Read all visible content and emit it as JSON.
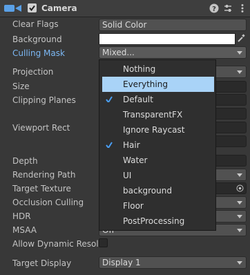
{
  "component": {
    "title": "Camera",
    "enabled": true
  },
  "fields": {
    "clear_flags": {
      "label": "Clear Flags",
      "value": "Solid Color"
    },
    "background": {
      "label": "Background"
    },
    "culling_mask": {
      "label": "Culling Mask",
      "value": "Mixed..."
    },
    "projection": {
      "label": "Projection"
    },
    "size": {
      "label": "Size"
    },
    "clipping_planes": {
      "label": "Clipping Planes"
    },
    "viewport_rect": {
      "label": "Viewport Rect"
    },
    "depth": {
      "label": "Depth"
    },
    "rendering_path": {
      "label": "Rendering Path"
    },
    "target_texture": {
      "label": "Target Texture"
    },
    "occlusion_culling": {
      "label": "Occlusion Culling"
    },
    "hdr": {
      "label": "HDR"
    },
    "msaa": {
      "label": "MSAA",
      "value": "Off"
    },
    "allow_dynamic_resolution": {
      "label": "Allow Dynamic Resolu"
    },
    "target_display": {
      "label": "Target Display",
      "value": "Display 1"
    }
  },
  "culling_mask_menu": {
    "options": [
      {
        "label": "Nothing",
        "checked": false,
        "highlighted": false
      },
      {
        "label": "Everything",
        "checked": false,
        "highlighted": true
      },
      {
        "label": "Default",
        "checked": true,
        "highlighted": false
      },
      {
        "label": "TransparentFX",
        "checked": false,
        "highlighted": false
      },
      {
        "label": "Ignore Raycast",
        "checked": false,
        "highlighted": false
      },
      {
        "label": "Hair",
        "checked": true,
        "highlighted": false
      },
      {
        "label": "Water",
        "checked": false,
        "highlighted": false
      },
      {
        "label": "UI",
        "checked": false,
        "highlighted": false
      },
      {
        "label": "background",
        "checked": false,
        "highlighted": false
      },
      {
        "label": "Floor",
        "checked": false,
        "highlighted": false
      },
      {
        "label": "PostProcessing",
        "checked": false,
        "highlighted": false
      }
    ]
  },
  "colors": {
    "accent_label": "#7cb8f4",
    "highlight": "#a9d3f7",
    "checkmark": "#4a9ff5",
    "background_swatch": "#ffffff"
  }
}
